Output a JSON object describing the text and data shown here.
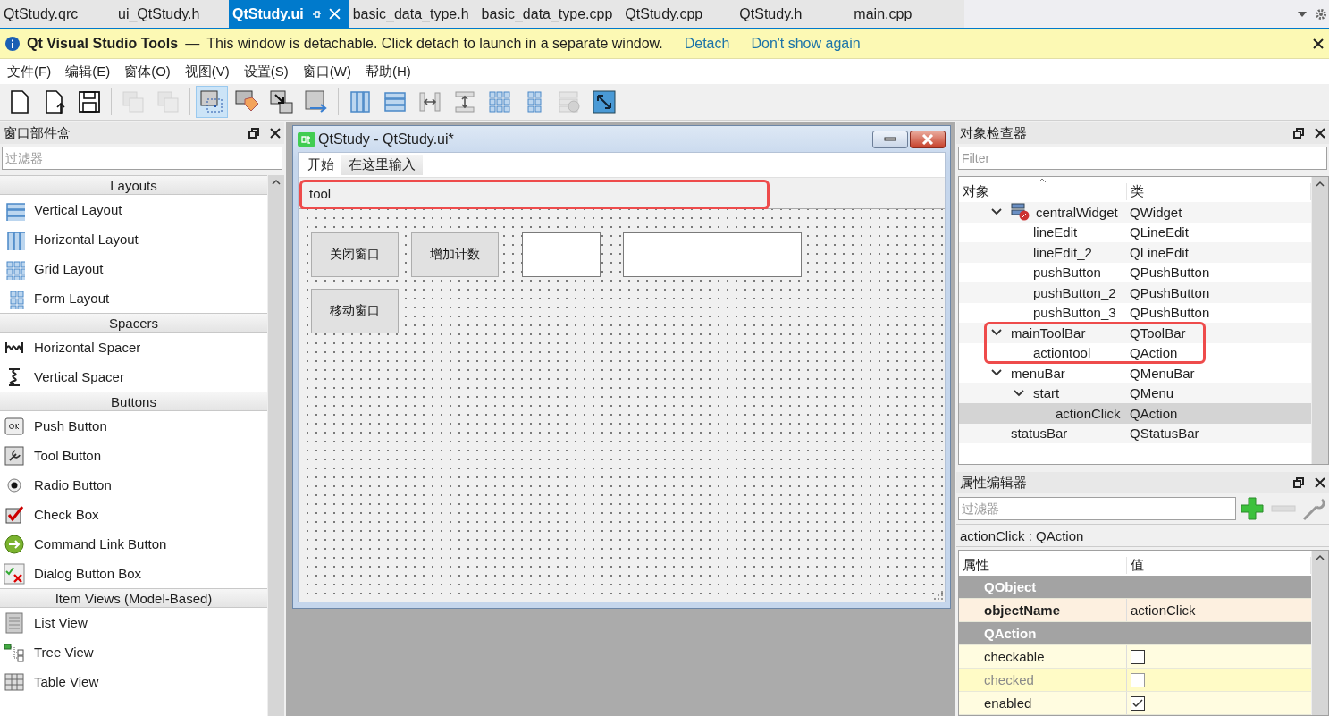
{
  "tabs": [
    {
      "label": "QtStudy.qrc",
      "selected": false
    },
    {
      "label": "ui_QtStudy.h",
      "selected": false
    },
    {
      "label": "QtStudy.ui",
      "selected": true
    },
    {
      "label": "basic_data_type.h",
      "selected": false
    },
    {
      "label": "basic_data_type.cpp",
      "selected": false
    },
    {
      "label": "QtStudy.cpp",
      "selected": false
    },
    {
      "label": "QtStudy.h",
      "selected": false
    },
    {
      "label": "main.cpp",
      "selected": false
    }
  ],
  "info_bar": {
    "product": "Qt Visual Studio Tools",
    "separator": "—",
    "message": "This window is detachable. Click detach to launch in a separate window.",
    "links": [
      "Detach",
      "Don't show again"
    ]
  },
  "menu": [
    "文件(F)",
    "编辑(E)",
    "窗体(O)",
    "视图(V)",
    "设置(S)",
    "窗口(W)",
    "帮助(H)"
  ],
  "toolbar": [
    {
      "kind": "new",
      "selected": false,
      "disabled": false
    },
    {
      "kind": "open",
      "selected": false,
      "disabled": false
    },
    {
      "kind": "save",
      "selected": false,
      "disabled": false
    },
    {
      "kind": "copy",
      "selected": false,
      "disabled": true
    },
    {
      "kind": "paste",
      "selected": false,
      "disabled": true
    },
    {
      "kind": "widgets",
      "selected": true,
      "disabled": false
    },
    {
      "kind": "buddy",
      "selected": false,
      "disabled": false
    },
    {
      "kind": "signals",
      "selected": false,
      "disabled": false
    },
    {
      "kind": "taborder",
      "selected": false,
      "disabled": false
    },
    {
      "kind": "hlayout",
      "selected": false,
      "disabled": false
    },
    {
      "kind": "vlayout",
      "selected": false,
      "disabled": false
    },
    {
      "kind": "hsplit",
      "selected": false,
      "disabled": false
    },
    {
      "kind": "vsplit",
      "selected": false,
      "disabled": false
    },
    {
      "kind": "grid",
      "selected": false,
      "disabled": false
    },
    {
      "kind": "form",
      "selected": false,
      "disabled": false
    },
    {
      "kind": "break",
      "selected": false,
      "disabled": true
    },
    {
      "kind": "adjust",
      "selected": false,
      "disabled": false
    }
  ],
  "widget_box": {
    "title": "窗口部件盒",
    "filter_placeholder": "过滤器",
    "categories": [
      {
        "name": "Layouts",
        "items": [
          {
            "label": "Vertical Layout",
            "kind": "vlayout"
          },
          {
            "label": "Horizontal Layout",
            "kind": "hlayout"
          },
          {
            "label": "Grid Layout",
            "kind": "grid"
          },
          {
            "label": "Form Layout",
            "kind": "form"
          }
        ]
      },
      {
        "name": "Spacers",
        "items": [
          {
            "label": "Horizontal Spacer",
            "kind": "hspacer"
          },
          {
            "label": "Vertical Spacer",
            "kind": "vspacer"
          }
        ]
      },
      {
        "name": "Buttons",
        "items": [
          {
            "label": "Push Button",
            "kind": "pushbutton"
          },
          {
            "label": "Tool Button",
            "kind": "toolbutton"
          },
          {
            "label": "Radio Button",
            "kind": "radio"
          },
          {
            "label": "Check Box",
            "kind": "checkbox"
          },
          {
            "label": "Command Link Button",
            "kind": "commandlink"
          },
          {
            "label": "Dialog Button Box",
            "kind": "dialogbuttons"
          }
        ]
      },
      {
        "name": "Item Views (Model-Based)",
        "items": [
          {
            "label": "List View",
            "kind": "listview"
          },
          {
            "label": "Tree View",
            "kind": "treeview"
          },
          {
            "label": "Table View",
            "kind": "tableview"
          }
        ]
      }
    ]
  },
  "form": {
    "title": "QtStudy - QtStudy.ui*",
    "menus": [
      {
        "label": "开始",
        "kind": "menu"
      },
      {
        "label": "在这里输入",
        "kind": "typehere"
      }
    ],
    "toolbar": {
      "actions": [
        "tool"
      ],
      "highlighted": true
    },
    "widgets": [
      {
        "kind": "button",
        "text": "关闭窗口"
      },
      {
        "kind": "button",
        "text": "增加计数"
      },
      {
        "kind": "lineedit"
      },
      {
        "kind": "lineedit"
      },
      {
        "kind": "button",
        "text": "移动窗口"
      }
    ]
  },
  "object_inspector": {
    "title": "对象检查器",
    "filter_placeholder": "Filter",
    "columns": [
      "对象",
      "类"
    ],
    "tree": [
      {
        "name": "centralWidget",
        "class": "QWidget",
        "icon": true,
        "expanded": true,
        "selected": false,
        "highlighted": false,
        "children": [
          {
            "name": "lineEdit",
            "class": "QLineEdit",
            "selected": false,
            "highlighted": false
          },
          {
            "name": "lineEdit_2",
            "class": "QLineEdit",
            "selected": false,
            "highlighted": false
          },
          {
            "name": "pushButton",
            "class": "QPushButton",
            "selected": false,
            "highlighted": false
          },
          {
            "name": "pushButton_2",
            "class": "QPushButton",
            "selected": false,
            "highlighted": false
          },
          {
            "name": "pushButton_3",
            "class": "QPushButton",
            "selected": false,
            "highlighted": false
          }
        ]
      },
      {
        "name": "mainToolBar",
        "class": "QToolBar",
        "expanded": true,
        "selected": false,
        "highlighted": true,
        "children": [
          {
            "name": "actiontool",
            "class": "QAction",
            "selected": false,
            "highlighted": false
          }
        ]
      },
      {
        "name": "menuBar",
        "class": "QMenuBar",
        "expanded": true,
        "selected": false,
        "highlighted": false,
        "children": [
          {
            "name": "start",
            "class": "QMenu",
            "expanded": true,
            "selected": false,
            "highlighted": false,
            "children": [
              {
                "name": "actionClick",
                "class": "QAction",
                "selected": true,
                "highlighted": false
              }
            ]
          }
        ]
      },
      {
        "name": "statusBar",
        "class": "QStatusBar",
        "selected": false,
        "highlighted": false
      }
    ]
  },
  "property_editor": {
    "title": "属性编辑器",
    "filter_placeholder": "过滤器",
    "object_label": "actionClick : QAction",
    "columns": [
      "属性",
      "值"
    ],
    "rows": [
      {
        "kind": "section",
        "label": "QObject"
      },
      {
        "kind": "text",
        "name": "objectName",
        "value": "actionClick",
        "modified": true,
        "disabled": false
      },
      {
        "kind": "section",
        "label": "QAction"
      },
      {
        "kind": "checkbox",
        "name": "checkable",
        "checked": false,
        "modified": false,
        "disabled": false
      },
      {
        "kind": "checkbox",
        "name": "checked",
        "checked": false,
        "modified": false,
        "disabled": true
      },
      {
        "kind": "checkbox",
        "name": "enabled",
        "checked": true,
        "modified": false,
        "disabled": false
      }
    ]
  }
}
